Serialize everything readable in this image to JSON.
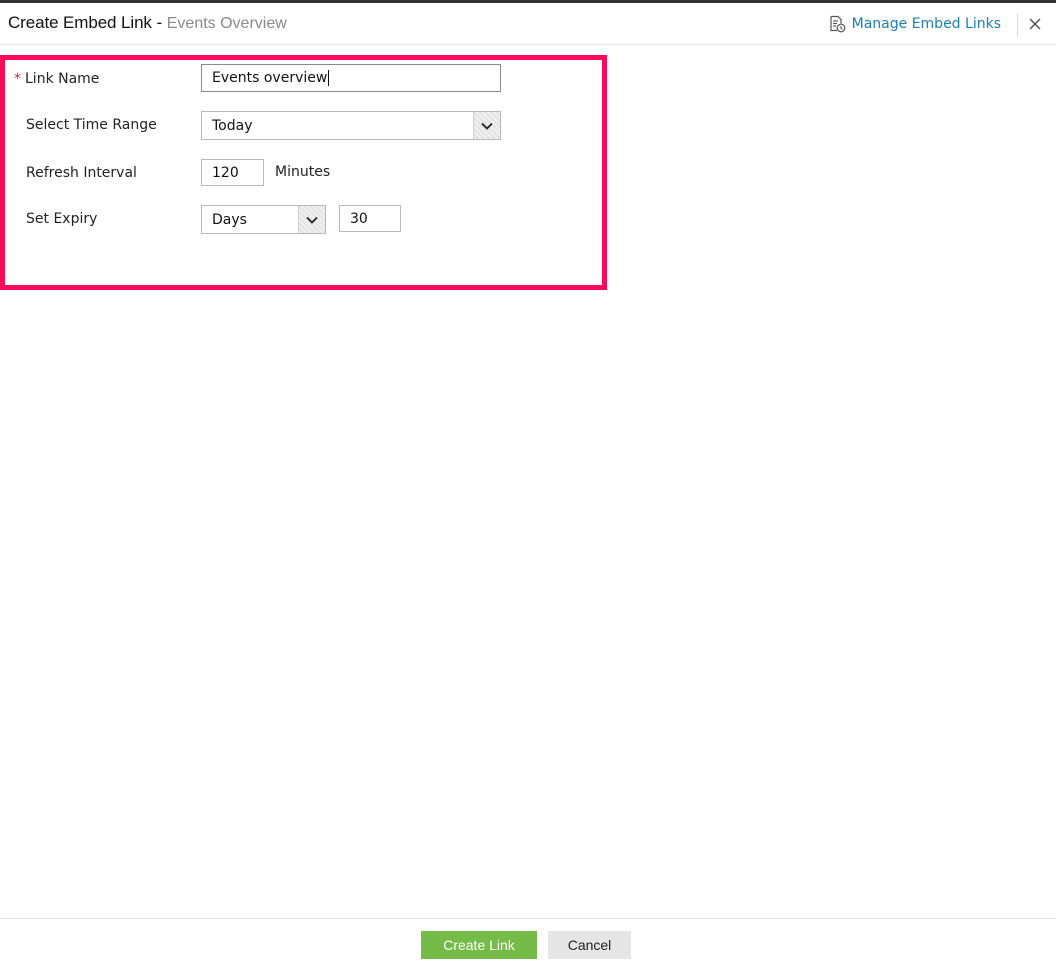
{
  "header": {
    "title": "Create Embed Link -",
    "subtitle": "Events Overview",
    "manage_label": "Manage Embed Links",
    "manage_icon": "manage-links-icon",
    "close_icon": "close-icon"
  },
  "form": {
    "link_name": {
      "label": "Link Name",
      "required_mark": "*",
      "value": "Events overview"
    },
    "time_range": {
      "label": "Select Time Range",
      "value": "Today"
    },
    "refresh_interval": {
      "label": "Refresh Interval",
      "value": "120",
      "unit": "Minutes"
    },
    "expiry": {
      "label": "Set Expiry",
      "unit_value": "Days",
      "value": "30"
    }
  },
  "footer": {
    "create_label": "Create Link",
    "cancel_label": "Cancel"
  },
  "colors": {
    "highlight": "#ff0a5a",
    "primary_button": "#75bb48",
    "link": "#1a7fb5",
    "required": "#d0243c"
  }
}
